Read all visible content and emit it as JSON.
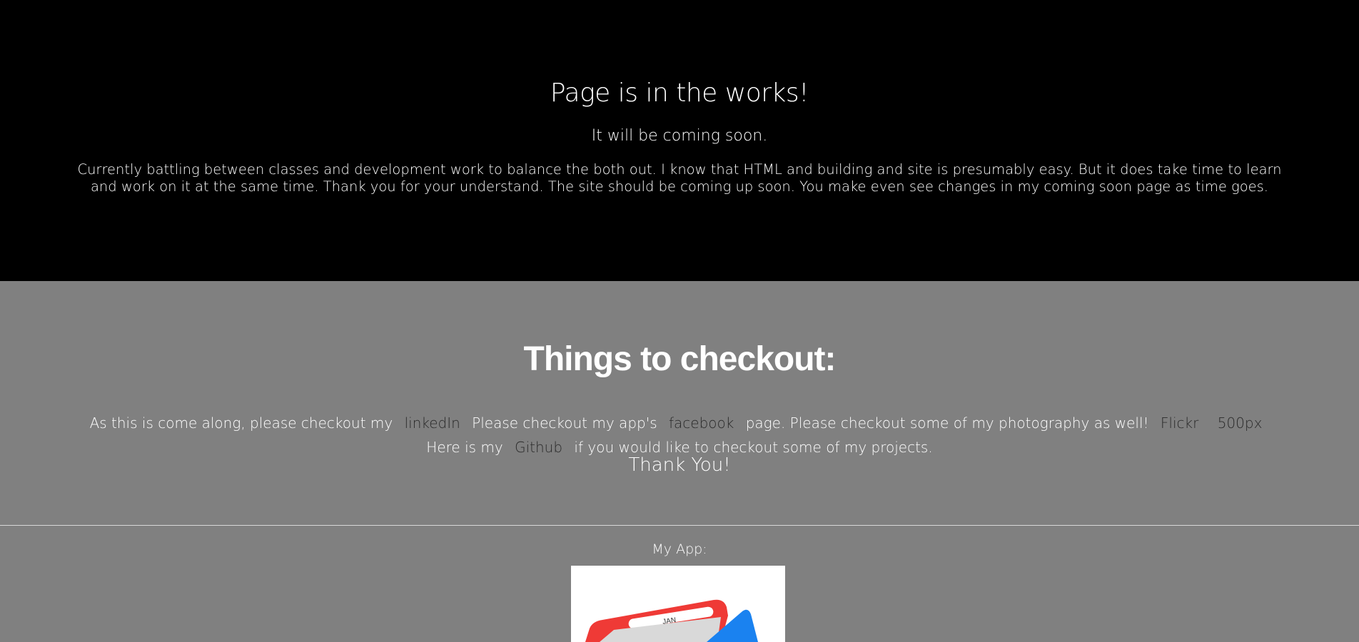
{
  "hero": {
    "title": "Page is in the works!",
    "subtitle": "It will be coming soon.",
    "paragraph": "Currently battling between classes and development work to balance the both out. I know that HTML and building and site is presumably easy. But it does take time to learn and work on it at the same time. Thank you for your understand. The site should be coming up soon. You make even see changes in my coming soon page as time goes."
  },
  "checkout": {
    "title": "Things to checkout:",
    "text_1": "As this is come along, please checkout my",
    "link_linkedin": "linkedIn",
    "text_2": "Please checkout my app's",
    "link_facebook": "facebook",
    "text_3": "page. Please checkout some of my photography as well!",
    "link_flickr": "Flickr",
    "link_500px": "500px",
    "text_4": "Here is my",
    "link_github": "Github",
    "text_5": "if you would like to checkout some of my projects.",
    "thanks": "Thank You!"
  },
  "my_app": {
    "label": "My App:",
    "image_text": "JAN"
  },
  "colors": {
    "hero_bg": "#000000",
    "section_bg": "#808080",
    "link": "#2a2a2a",
    "text": "#ffffff"
  }
}
